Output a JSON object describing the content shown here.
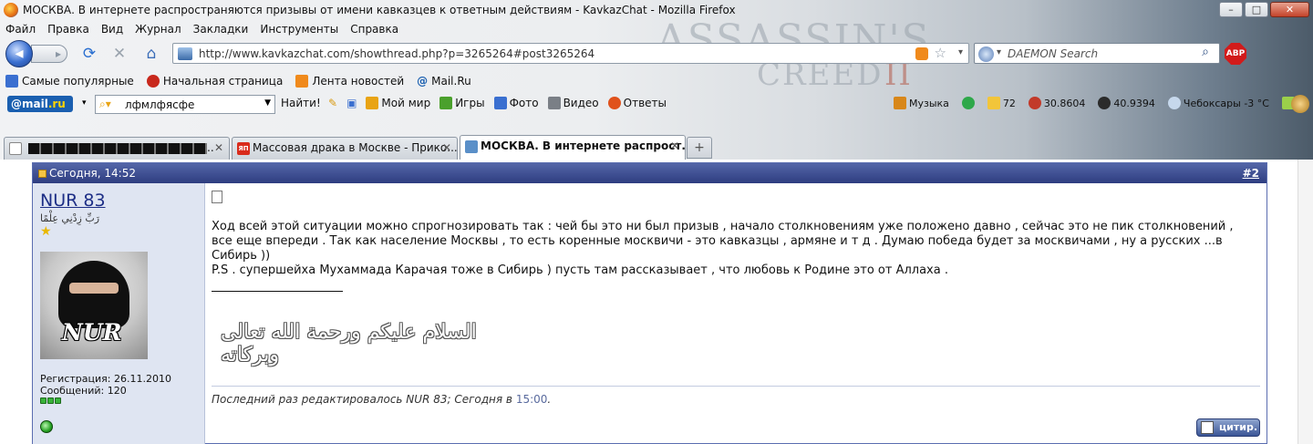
{
  "window": {
    "title": "МОСКВА. В интернете распространяются призывы от имени кавказцев к ответным действиям - KavkazChat - Mozilla Firefox",
    "buttons": {
      "minimize": "–",
      "maximize": "□",
      "close": "✕"
    }
  },
  "background_art": {
    "line1": "ASSASSIN'S",
    "line2": "CREED",
    "numeral": "II"
  },
  "menu": [
    "Файл",
    "Правка",
    "Вид",
    "Журнал",
    "Закладки",
    "Инструменты",
    "Справка"
  ],
  "navigation": {
    "url": "http://www.kavkazchat.com/showthread.php?p=3265264#post3265264",
    "search_placeholder": "DAEMON Search",
    "adblock_label": "ABP"
  },
  "bookmarks": [
    {
      "label": "Самые популярные",
      "icon": "bookmark-icon",
      "color": "#3a6fd0"
    },
    {
      "label": "Начальная страница",
      "icon": "home-icon",
      "color": "#c8281c"
    },
    {
      "label": "Лента новостей",
      "icon": "rss-icon",
      "color": "#f08a1c"
    },
    {
      "label": "Mail.Ru",
      "icon": "at-icon",
      "color": "#1a5fb0"
    }
  ],
  "mailru_bar": {
    "logo_at": "@mail",
    "logo_dom": ".ru",
    "search_value": "лфмлфясфе",
    "find_label": "Найти!",
    "items": [
      {
        "label": "Мой мир",
        "icon": "people-icon"
      },
      {
        "label": "Игры",
        "icon": "game-icon"
      },
      {
        "label": "Фото",
        "icon": "photo-icon"
      },
      {
        "label": "Видео",
        "icon": "video-icon"
      },
      {
        "label": "Ответы",
        "icon": "answers-icon"
      }
    ],
    "right_items": {
      "music": "Музыка",
      "mail_count": "72",
      "usd": "30.8604",
      "eur": "40.9394",
      "weather": "Чебоксары -3 °C"
    }
  },
  "tabs": [
    {
      "label": "",
      "favicon_color": "#ffffff",
      "redacted": true,
      "active": false
    },
    {
      "label": "Массовая драка в Москве - Прико...",
      "favicon_color": "#d92b1c",
      "favicon_text": "ЯП",
      "active": false
    },
    {
      "label": "МОСКВА. В интернете распрост...",
      "favicon_color": "#5a8fc8",
      "active": true
    }
  ],
  "post": {
    "date": "Сегодня, 14:52",
    "number": "#2",
    "username": "NUR 83",
    "user_title": "رَبِّ زِدْنِي عِلْمًا",
    "avatar_label": "NUR",
    "registration": "Регистрация: 26.11.2010",
    "messages": "Сообщений: 120",
    "body_lines": [
      "Ход всей этой ситуации можно спрогнозировать так : чей бы это ни был призыв , начало столкновениям уже положено давно , сейчас это не пик столкновений , все еще впереди . Так как население Москвы , то есть коренные москвичи - это кавказцы , армяне и т д . Думаю победа будет за москвичами , ну а русских ...в Сибирь ))",
      "P.S . супершейха Мухаммада Карачая тоже в Сибирь ) пусть там рассказывает , что любовь к Родине это от Аллаха ."
    ],
    "signature_arabic": "السلام عليكم ورحمة الله تعالى وبركاته",
    "edit_prefix": "Последний раз редактировалось NUR 83; Сегодня в ",
    "edit_time": "15:00",
    "edit_suffix": ".",
    "quote_button": "цитир."
  }
}
